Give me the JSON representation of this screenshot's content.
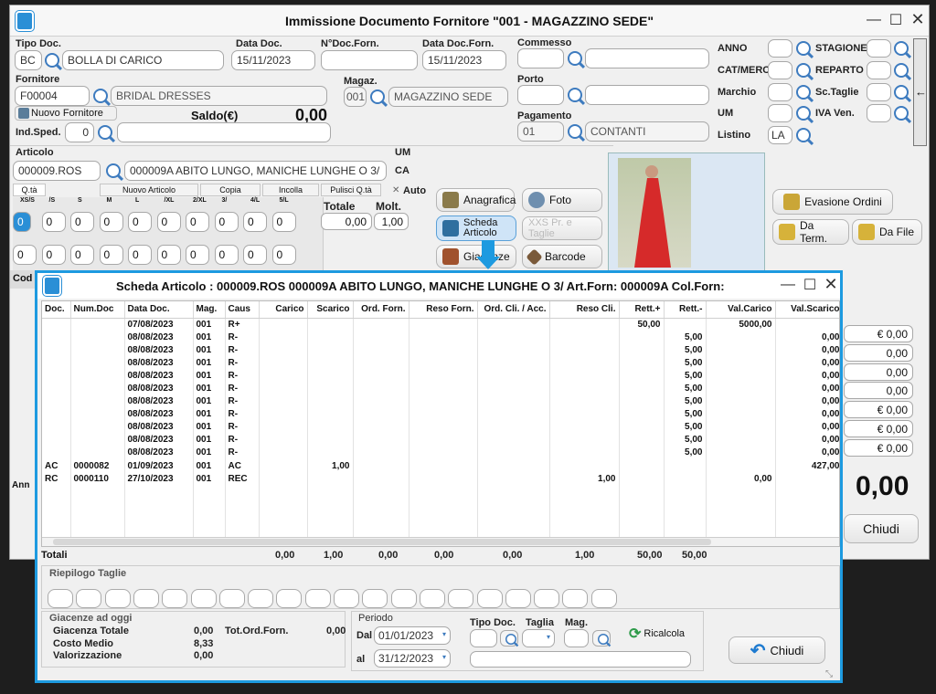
{
  "main": {
    "title": "Immissione Documento Fornitore \"001 - MAGAZZINO SEDE\"",
    "tipo_doc_label": "Tipo Doc.",
    "tipo_doc_code": "BC",
    "tipo_doc_desc": "BOLLA DI CARICO",
    "data_doc_label": "Data Doc.",
    "data_doc": "15/11/2023",
    "ndoc_forn_label": "N°Doc.Forn.",
    "data_doc_forn_label": "Data Doc.Forn.",
    "data_doc_forn": "15/11/2023",
    "commesso_label": "Commesso",
    "fornitore_label": "Fornitore",
    "fornitore_code": "F00004",
    "fornitore_desc": "BRIDAL DRESSES",
    "magaz_label": "Magaz.",
    "magaz_code": "001",
    "magaz_desc": "MAGAZZINO SEDE",
    "porto_label": "Porto",
    "nuovo_fornitore": "Nuovo Fornitore",
    "saldo_label": "Saldo(€)",
    "saldo_value": "0,00",
    "ind_sped_label": "Ind.Sped.",
    "ind_sped_value": "0",
    "pagamento_label": "Pagamento",
    "pag_code": "01",
    "pag_desc": "CONTANTI",
    "anno_label": "ANNO",
    "stagione_label": "STAGIONE",
    "catmerc_label": "CAT/MERC",
    "reparto_label": "REPARTO",
    "marchio_label": "Marchio",
    "sctaglie_label": "Sc.Taglie",
    "um_label": "UM",
    "iva_label": "IVA Ven.",
    "listino_label": "Listino",
    "listino_value": "LA",
    "articolo_label": "Articolo",
    "um2_label": "UM",
    "ca_label": "CA",
    "articolo_code": "000009.ROS",
    "articolo_desc": "000009A ABITO LUNGO, MANICHE LUNGHE O 3/",
    "qta_tab": "Q.tà",
    "nuovo_articolo": "Nuovo Articolo",
    "copia": "Copia",
    "incolla": "Incolla",
    "pulisci": "Pulisci Q.tà",
    "auto": "Auto",
    "size_labels": [
      "XS/S",
      "/S",
      "S",
      "M",
      "L",
      "/XL",
      "2/XL",
      "3/",
      "4/L",
      "5/L"
    ],
    "qty_row1": [
      "0",
      "0",
      "0",
      "0",
      "0",
      "0",
      "0",
      "0",
      "0",
      "0"
    ],
    "qty_row2": [
      "0",
      "0",
      "0",
      "0",
      "0",
      "0",
      "0",
      "0",
      "0",
      "0"
    ],
    "totale_label": "Totale",
    "totale_value": "0,00",
    "molt_label": "Molt.",
    "molt_value": "1,00",
    "anagrafica": "Anagrafica",
    "foto": "Foto",
    "scheda_articolo": "Scheda Articolo",
    "xxs_taglie": "XXS Pr. e Taglie",
    "giacenze": "Giacenze",
    "barcode": "Barcode",
    "evasione_ordini": "Evasione Ordini",
    "da_term": "Da Term.",
    "da_file": "Da File",
    "cod_header": "Cod",
    "anno_short": "Ann",
    "values_right": [
      "€ 0,00",
      "0,00",
      "0,00",
      "0,00",
      "€ 0,00",
      "€ 0,00",
      "€ 0,00"
    ],
    "big_total": "0,00",
    "chiudi": "Chiudi"
  },
  "scheda": {
    "title": "Scheda Articolo : 000009.ROS   000009A ABITO LUNGO, MANICHE LUNGHE O 3/   Art.Forn: 000009A   Col.Forn:",
    "columns": [
      "Doc.",
      "Num.Doc",
      "Data Doc.",
      "Mag.",
      "Caus",
      "Carico",
      "Scarico",
      "Ord. Forn.",
      "Reso Forn.",
      "Ord. Cli. / Acc.",
      "Reso Cli.",
      "Rett.+",
      "Rett.-",
      "Val.Carico",
      "Val.Scarico"
    ],
    "rows": [
      [
        "",
        "",
        "07/08/2023",
        "001",
        "R+",
        "",
        "",
        "",
        "",
        "",
        "",
        "50,00",
        "",
        "5000,00",
        ""
      ],
      [
        "",
        "",
        "08/08/2023",
        "001",
        "R-",
        "",
        "",
        "",
        "",
        "",
        "",
        "",
        "5,00",
        "",
        "0,00"
      ],
      [
        "",
        "",
        "08/08/2023",
        "001",
        "R-",
        "",
        "",
        "",
        "",
        "",
        "",
        "",
        "5,00",
        "",
        "0,00"
      ],
      [
        "",
        "",
        "08/08/2023",
        "001",
        "R-",
        "",
        "",
        "",
        "",
        "",
        "",
        "",
        "5,00",
        "",
        "0,00"
      ],
      [
        "",
        "",
        "08/08/2023",
        "001",
        "R-",
        "",
        "",
        "",
        "",
        "",
        "",
        "",
        "5,00",
        "",
        "0,00"
      ],
      [
        "",
        "",
        "08/08/2023",
        "001",
        "R-",
        "",
        "",
        "",
        "",
        "",
        "",
        "",
        "5,00",
        "",
        "0,00"
      ],
      [
        "",
        "",
        "08/08/2023",
        "001",
        "R-",
        "",
        "",
        "",
        "",
        "",
        "",
        "",
        "5,00",
        "",
        "0,00"
      ],
      [
        "",
        "",
        "08/08/2023",
        "001",
        "R-",
        "",
        "",
        "",
        "",
        "",
        "",
        "",
        "5,00",
        "",
        "0,00"
      ],
      [
        "",
        "",
        "08/08/2023",
        "001",
        "R-",
        "",
        "",
        "",
        "",
        "",
        "",
        "",
        "5,00",
        "",
        "0,00"
      ],
      [
        "",
        "",
        "08/08/2023",
        "001",
        "R-",
        "",
        "",
        "",
        "",
        "",
        "",
        "",
        "5,00",
        "",
        "0,00"
      ],
      [
        "",
        "",
        "08/08/2023",
        "001",
        "R-",
        "",
        "",
        "",
        "",
        "",
        "",
        "",
        "5,00",
        "",
        "0,00"
      ],
      [
        "AC",
        "0000082",
        "01/09/2023",
        "001",
        "AC",
        "",
        "1,00",
        "",
        "",
        "",
        "",
        "",
        "",
        "",
        "427,00"
      ],
      [
        "RC",
        "0000110",
        "27/10/2023",
        "001",
        "REC",
        "",
        "",
        "",
        "",
        "",
        "1,00",
        "",
        "",
        "0,00",
        ""
      ]
    ],
    "totali_label": "Totali",
    "totali": [
      "0,00",
      "1,00",
      "0,00",
      "0,00",
      "0,00",
      "1,00",
      "50,00",
      "50,00"
    ],
    "riepilogo_label": "Riepilogo Taglie",
    "giacenze_label": "Giacenze ad oggi",
    "giacenza_totale_label": "Giacenza Totale",
    "giacenza_totale": "0,00",
    "tot_ord_forn_label": "Tot.Ord.Forn.",
    "tot_ord_forn": "0,00",
    "costo_medio_label": "Costo Medio",
    "costo_medio": "8,33",
    "valorizzazione_label": "Valorizzazione",
    "valorizzazione": "0,00",
    "periodo_label": "Periodo",
    "dal_label": "Dal",
    "dal": "01/01/2023",
    "al_label": "al",
    "al": "31/12/2023",
    "tipo_doc_label": "Tipo Doc.",
    "taglia_label": "Taglia",
    "mag_label": "Mag.",
    "ricalcola": "Ricalcola",
    "chiudi": "Chiudi"
  }
}
